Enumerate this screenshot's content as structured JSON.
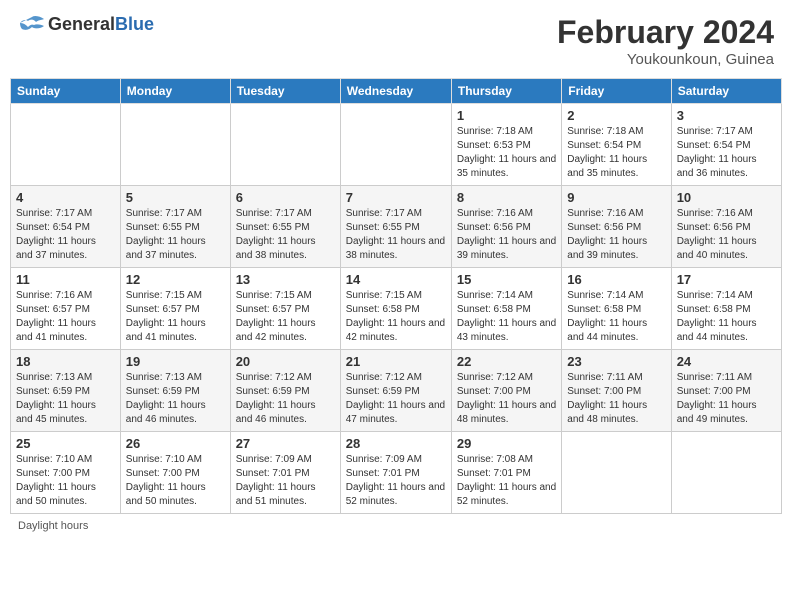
{
  "header": {
    "logo_general": "General",
    "logo_blue": "Blue",
    "title": "February 2024",
    "subtitle": "Youkounkoun, Guinea"
  },
  "days_of_week": [
    "Sunday",
    "Monday",
    "Tuesday",
    "Wednesday",
    "Thursday",
    "Friday",
    "Saturday"
  ],
  "weeks": [
    [
      {
        "day": "",
        "info": ""
      },
      {
        "day": "",
        "info": ""
      },
      {
        "day": "",
        "info": ""
      },
      {
        "day": "",
        "info": ""
      },
      {
        "day": "1",
        "info": "Sunrise: 7:18 AM\nSunset: 6:53 PM\nDaylight: 11 hours and 35 minutes."
      },
      {
        "day": "2",
        "info": "Sunrise: 7:18 AM\nSunset: 6:54 PM\nDaylight: 11 hours and 35 minutes."
      },
      {
        "day": "3",
        "info": "Sunrise: 7:17 AM\nSunset: 6:54 PM\nDaylight: 11 hours and 36 minutes."
      }
    ],
    [
      {
        "day": "4",
        "info": "Sunrise: 7:17 AM\nSunset: 6:54 PM\nDaylight: 11 hours and 37 minutes."
      },
      {
        "day": "5",
        "info": "Sunrise: 7:17 AM\nSunset: 6:55 PM\nDaylight: 11 hours and 37 minutes."
      },
      {
        "day": "6",
        "info": "Sunrise: 7:17 AM\nSunset: 6:55 PM\nDaylight: 11 hours and 38 minutes."
      },
      {
        "day": "7",
        "info": "Sunrise: 7:17 AM\nSunset: 6:55 PM\nDaylight: 11 hours and 38 minutes."
      },
      {
        "day": "8",
        "info": "Sunrise: 7:16 AM\nSunset: 6:56 PM\nDaylight: 11 hours and 39 minutes."
      },
      {
        "day": "9",
        "info": "Sunrise: 7:16 AM\nSunset: 6:56 PM\nDaylight: 11 hours and 39 minutes."
      },
      {
        "day": "10",
        "info": "Sunrise: 7:16 AM\nSunset: 6:56 PM\nDaylight: 11 hours and 40 minutes."
      }
    ],
    [
      {
        "day": "11",
        "info": "Sunrise: 7:16 AM\nSunset: 6:57 PM\nDaylight: 11 hours and 41 minutes."
      },
      {
        "day": "12",
        "info": "Sunrise: 7:15 AM\nSunset: 6:57 PM\nDaylight: 11 hours and 41 minutes."
      },
      {
        "day": "13",
        "info": "Sunrise: 7:15 AM\nSunset: 6:57 PM\nDaylight: 11 hours and 42 minutes."
      },
      {
        "day": "14",
        "info": "Sunrise: 7:15 AM\nSunset: 6:58 PM\nDaylight: 11 hours and 42 minutes."
      },
      {
        "day": "15",
        "info": "Sunrise: 7:14 AM\nSunset: 6:58 PM\nDaylight: 11 hours and 43 minutes."
      },
      {
        "day": "16",
        "info": "Sunrise: 7:14 AM\nSunset: 6:58 PM\nDaylight: 11 hours and 44 minutes."
      },
      {
        "day": "17",
        "info": "Sunrise: 7:14 AM\nSunset: 6:58 PM\nDaylight: 11 hours and 44 minutes."
      }
    ],
    [
      {
        "day": "18",
        "info": "Sunrise: 7:13 AM\nSunset: 6:59 PM\nDaylight: 11 hours and 45 minutes."
      },
      {
        "day": "19",
        "info": "Sunrise: 7:13 AM\nSunset: 6:59 PM\nDaylight: 11 hours and 46 minutes."
      },
      {
        "day": "20",
        "info": "Sunrise: 7:12 AM\nSunset: 6:59 PM\nDaylight: 11 hours and 46 minutes."
      },
      {
        "day": "21",
        "info": "Sunrise: 7:12 AM\nSunset: 6:59 PM\nDaylight: 11 hours and 47 minutes."
      },
      {
        "day": "22",
        "info": "Sunrise: 7:12 AM\nSunset: 7:00 PM\nDaylight: 11 hours and 48 minutes."
      },
      {
        "day": "23",
        "info": "Sunrise: 7:11 AM\nSunset: 7:00 PM\nDaylight: 11 hours and 48 minutes."
      },
      {
        "day": "24",
        "info": "Sunrise: 7:11 AM\nSunset: 7:00 PM\nDaylight: 11 hours and 49 minutes."
      }
    ],
    [
      {
        "day": "25",
        "info": "Sunrise: 7:10 AM\nSunset: 7:00 PM\nDaylight: 11 hours and 50 minutes."
      },
      {
        "day": "26",
        "info": "Sunrise: 7:10 AM\nSunset: 7:00 PM\nDaylight: 11 hours and 50 minutes."
      },
      {
        "day": "27",
        "info": "Sunrise: 7:09 AM\nSunset: 7:01 PM\nDaylight: 11 hours and 51 minutes."
      },
      {
        "day": "28",
        "info": "Sunrise: 7:09 AM\nSunset: 7:01 PM\nDaylight: 11 hours and 52 minutes."
      },
      {
        "day": "29",
        "info": "Sunrise: 7:08 AM\nSunset: 7:01 PM\nDaylight: 11 hours and 52 minutes."
      },
      {
        "day": "",
        "info": ""
      },
      {
        "day": "",
        "info": ""
      }
    ]
  ],
  "footer": "Daylight hours"
}
